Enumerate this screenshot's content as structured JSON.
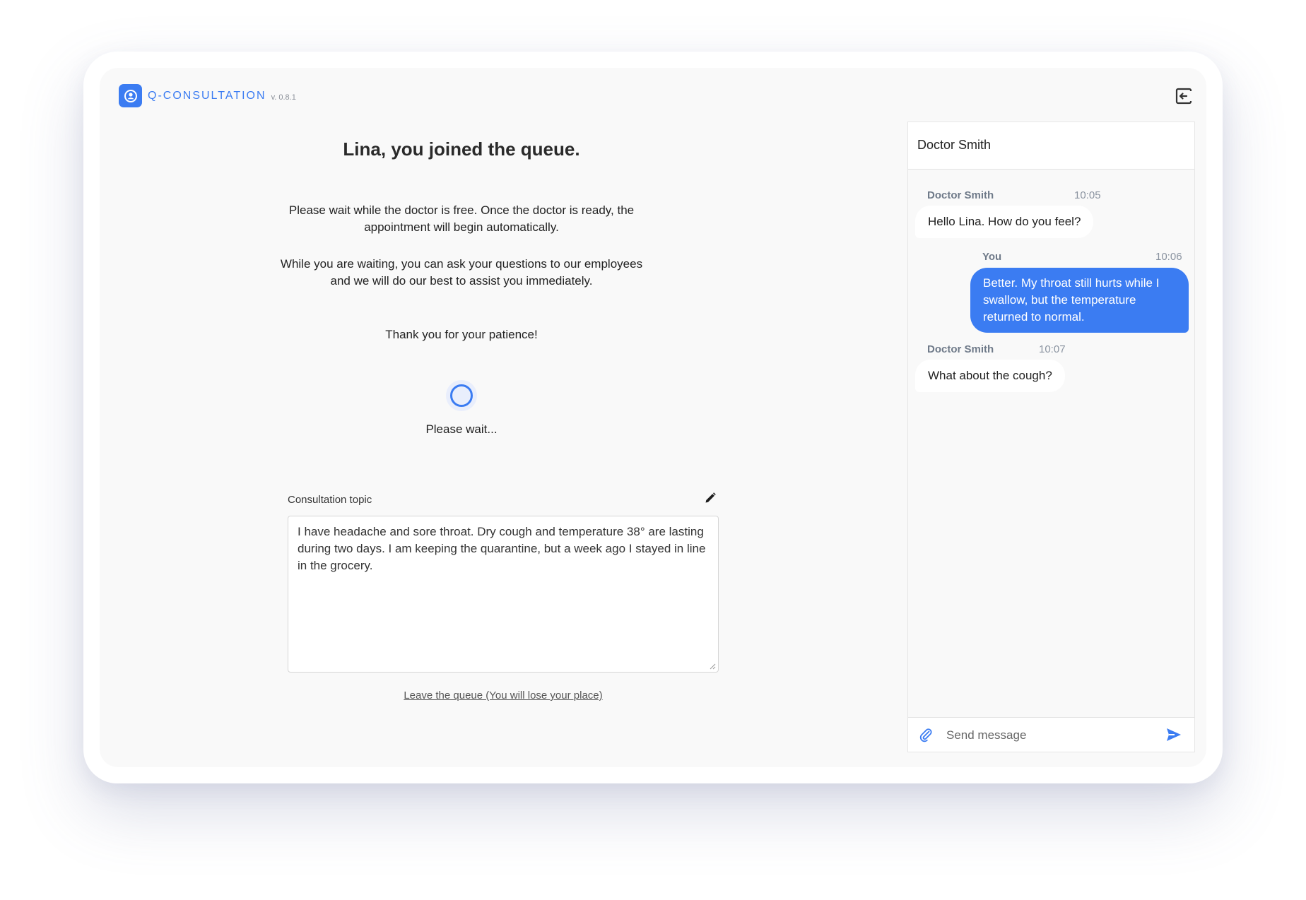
{
  "header": {
    "brand_name": "Q-CONSULTATION",
    "version": "v. 0.8.1",
    "exit_icon": "logout-icon"
  },
  "queue": {
    "title": "Lina, you joined the queue.",
    "paragraph1": "Please wait while the doctor is free. Once the doctor is ready, the appointment will begin automatically.",
    "paragraph2": "While you are waiting, you can ask your questions to our employees and we will do our best to assist you immediately.",
    "paragraph3": "Thank you for your patience!",
    "wait_text": "Please wait..."
  },
  "topic": {
    "label": "Consultation topic",
    "text": "I have headache and sore throat. Dry cough and temperature 38° are lasting during two days. I am keeping the quarantine, but a week ago I stayed in line in the grocery.",
    "leave_link": "Leave the queue (You will lose your place)"
  },
  "chat": {
    "title": "Doctor Smith",
    "messages": [
      {
        "sender": "Doctor Smith",
        "time": "10:05",
        "text": "Hello Lina. How do you feel?",
        "direction": "in"
      },
      {
        "sender": "You",
        "time": "10:06",
        "text": "Better. My throat still hurts while I swallow, but the temperature returned to normal.",
        "direction": "out"
      },
      {
        "sender": "Doctor Smith",
        "time": "10:07",
        "text": "What about the cough?",
        "direction": "in"
      }
    ],
    "input_placeholder": "Send message"
  },
  "colors": {
    "accent": "#3b7cf2",
    "background": "#f9f9f9"
  }
}
